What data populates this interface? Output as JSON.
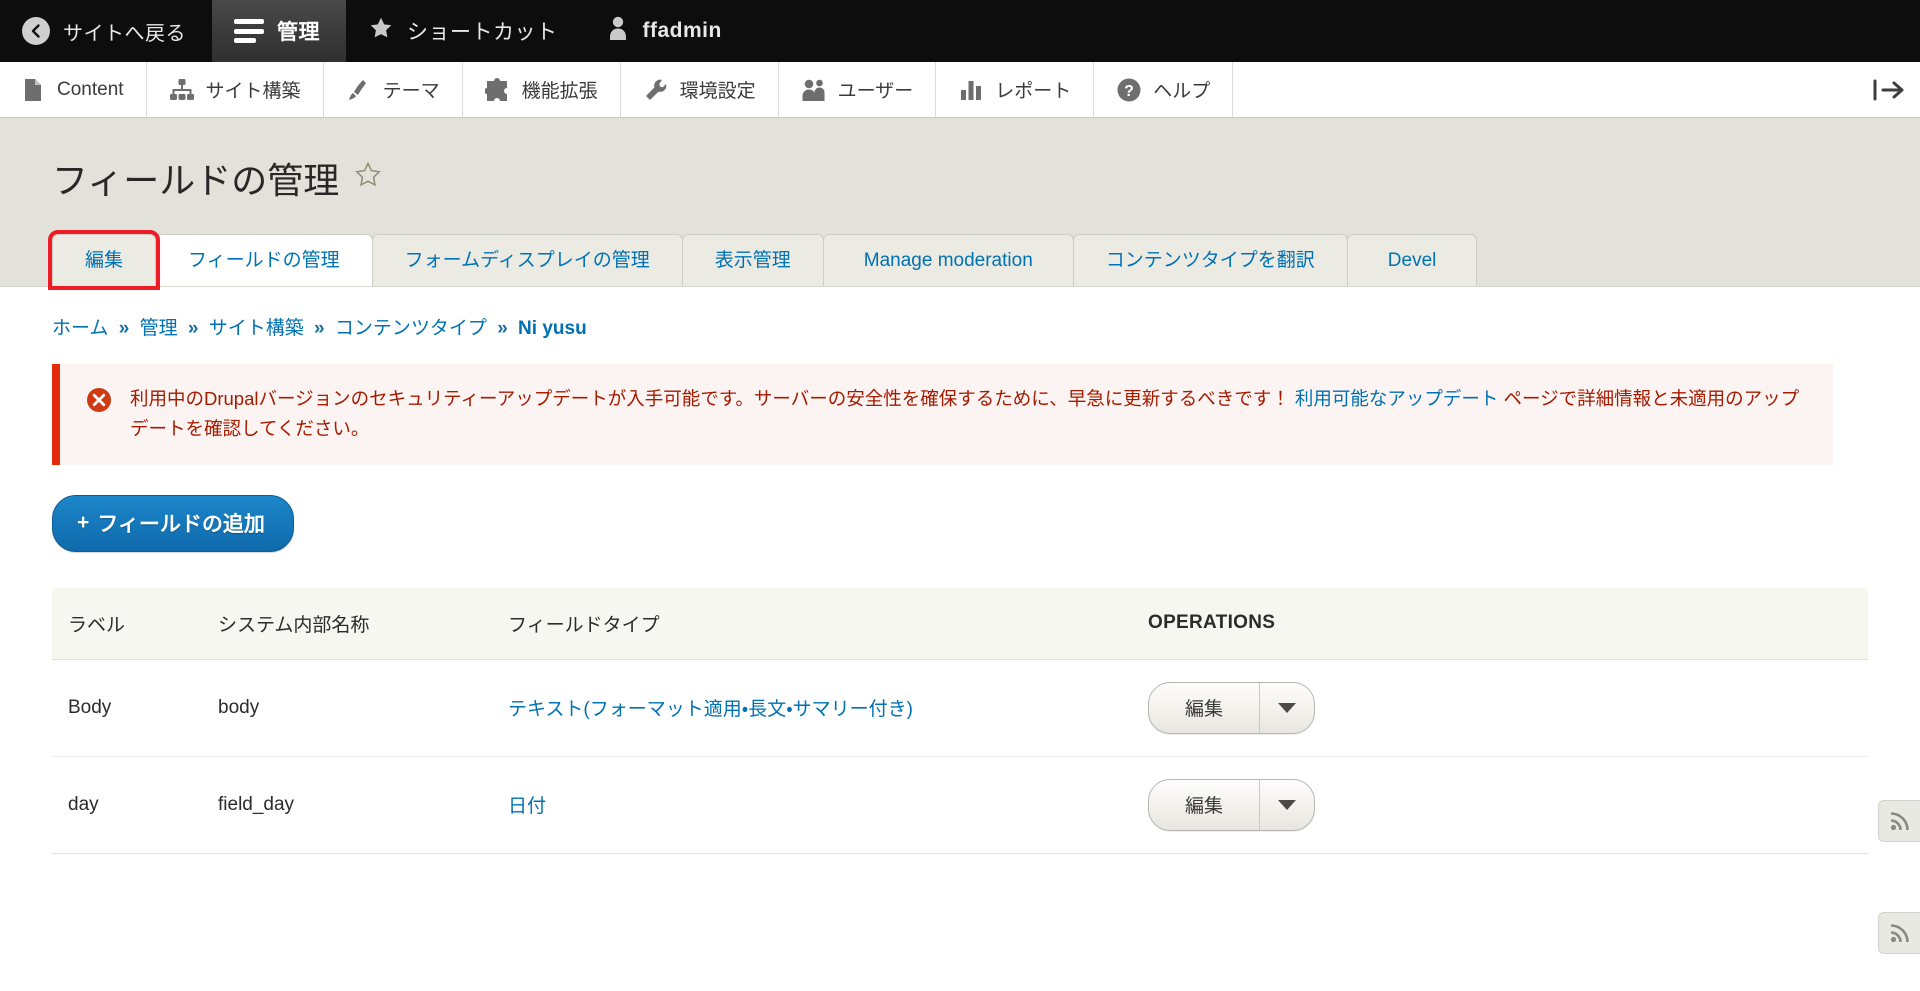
{
  "toolbar": {
    "back_to_site": "サイトへ戻る",
    "manage": "管理",
    "shortcuts": "ショートカット",
    "user": "ffadmin"
  },
  "menu": {
    "items": [
      {
        "label": "Content",
        "icon": "content-page-icon"
      },
      {
        "label": "サイト構築",
        "icon": "structure-icon"
      },
      {
        "label": "テーマ",
        "icon": "appearance-brush-icon"
      },
      {
        "label": "機能拡張",
        "icon": "extend-puzzle-icon"
      },
      {
        "label": "環境設定",
        "icon": "configuration-wrench-icon"
      },
      {
        "label": "ユーザー",
        "icon": "people-icon"
      },
      {
        "label": "レポート",
        "icon": "reports-bar-chart-icon"
      },
      {
        "label": "ヘルプ",
        "icon": "help-question-icon"
      }
    ]
  },
  "page": {
    "title": "フィールドの管理",
    "favorite_icon": "star-outline-icon"
  },
  "tabs": [
    {
      "label": "編集",
      "active": false,
      "highlighted": true
    },
    {
      "label": "フィールドの管理",
      "active": true,
      "highlighted": false
    },
    {
      "label": "フォームディスプレイの管理",
      "active": false,
      "highlighted": false
    },
    {
      "label": "表示管理",
      "active": false,
      "highlighted": false
    },
    {
      "label": "Manage moderation",
      "active": false,
      "highlighted": false
    },
    {
      "label": "コンテンツタイプを翻訳",
      "active": false,
      "highlighted": false
    },
    {
      "label": "Devel",
      "active": false,
      "highlighted": false
    }
  ],
  "breadcrumb": {
    "separator": "»",
    "items": [
      {
        "label": "ホーム",
        "current": false
      },
      {
        "label": "管理",
        "current": false
      },
      {
        "label": "サイト構築",
        "current": false
      },
      {
        "label": "コンテンツタイプ",
        "current": false
      },
      {
        "label": "Ni yusu",
        "current": true
      }
    ]
  },
  "message": {
    "type": "error",
    "icon": "error-circle-x-icon",
    "text_before_link": "利用中のDrupalバージョンのセキュリティーアップデートが入手可能です。サーバーの安全性を確保するために、早急に更新するべきです！ ",
    "link_text": "利用可能なアップデート",
    "text_after_link": " ページで詳細情報と未適用のアップデートを確認してください。"
  },
  "actions": {
    "add_field_label": "フィールドの追加",
    "add_field_plus": "+"
  },
  "table": {
    "headers": [
      "ラベル",
      "システム内部名称",
      "フィールドタイプ",
      "OPERATIONS"
    ],
    "rows": [
      {
        "label": "Body",
        "machine_name": "body",
        "field_type": "テキスト(フォーマット適用・長文・サマリー付き)",
        "operation_label": "編集"
      },
      {
        "label": "day",
        "machine_name": "field_day",
        "field_type": "日付",
        "operation_label": "編集"
      }
    ]
  },
  "colors": {
    "link": "#0071b3",
    "error_border": "#e52b0b",
    "error_text": "#a51b00",
    "primary_button": "#1578bb",
    "highlight_outline": "#ee1c25",
    "toolbar_bg": "#0d0d0d",
    "page_head_bg": "#e2e2da"
  }
}
